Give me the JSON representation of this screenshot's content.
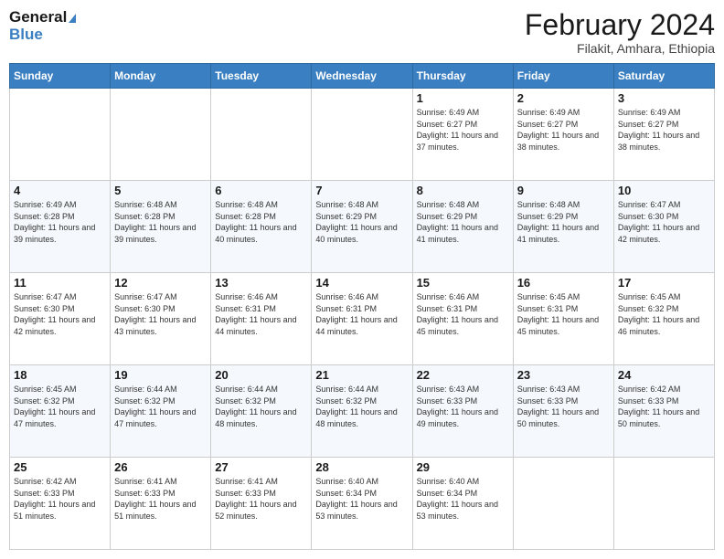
{
  "header": {
    "logo_general": "General",
    "logo_blue": "Blue",
    "title": "February 2024",
    "subtitle": "Filakit, Amhara, Ethiopia"
  },
  "days_of_week": [
    "Sunday",
    "Monday",
    "Tuesday",
    "Wednesday",
    "Thursday",
    "Friday",
    "Saturday"
  ],
  "weeks": [
    [
      {
        "num": "",
        "info": ""
      },
      {
        "num": "",
        "info": ""
      },
      {
        "num": "",
        "info": ""
      },
      {
        "num": "",
        "info": ""
      },
      {
        "num": "1",
        "info": "Sunrise: 6:49 AM\nSunset: 6:27 PM\nDaylight: 11 hours and 37 minutes."
      },
      {
        "num": "2",
        "info": "Sunrise: 6:49 AM\nSunset: 6:27 PM\nDaylight: 11 hours and 38 minutes."
      },
      {
        "num": "3",
        "info": "Sunrise: 6:49 AM\nSunset: 6:27 PM\nDaylight: 11 hours and 38 minutes."
      }
    ],
    [
      {
        "num": "4",
        "info": "Sunrise: 6:49 AM\nSunset: 6:28 PM\nDaylight: 11 hours and 39 minutes."
      },
      {
        "num": "5",
        "info": "Sunrise: 6:48 AM\nSunset: 6:28 PM\nDaylight: 11 hours and 39 minutes."
      },
      {
        "num": "6",
        "info": "Sunrise: 6:48 AM\nSunset: 6:28 PM\nDaylight: 11 hours and 40 minutes."
      },
      {
        "num": "7",
        "info": "Sunrise: 6:48 AM\nSunset: 6:29 PM\nDaylight: 11 hours and 40 minutes."
      },
      {
        "num": "8",
        "info": "Sunrise: 6:48 AM\nSunset: 6:29 PM\nDaylight: 11 hours and 41 minutes."
      },
      {
        "num": "9",
        "info": "Sunrise: 6:48 AM\nSunset: 6:29 PM\nDaylight: 11 hours and 41 minutes."
      },
      {
        "num": "10",
        "info": "Sunrise: 6:47 AM\nSunset: 6:30 PM\nDaylight: 11 hours and 42 minutes."
      }
    ],
    [
      {
        "num": "11",
        "info": "Sunrise: 6:47 AM\nSunset: 6:30 PM\nDaylight: 11 hours and 42 minutes."
      },
      {
        "num": "12",
        "info": "Sunrise: 6:47 AM\nSunset: 6:30 PM\nDaylight: 11 hours and 43 minutes."
      },
      {
        "num": "13",
        "info": "Sunrise: 6:46 AM\nSunset: 6:31 PM\nDaylight: 11 hours and 44 minutes."
      },
      {
        "num": "14",
        "info": "Sunrise: 6:46 AM\nSunset: 6:31 PM\nDaylight: 11 hours and 44 minutes."
      },
      {
        "num": "15",
        "info": "Sunrise: 6:46 AM\nSunset: 6:31 PM\nDaylight: 11 hours and 45 minutes."
      },
      {
        "num": "16",
        "info": "Sunrise: 6:45 AM\nSunset: 6:31 PM\nDaylight: 11 hours and 45 minutes."
      },
      {
        "num": "17",
        "info": "Sunrise: 6:45 AM\nSunset: 6:32 PM\nDaylight: 11 hours and 46 minutes."
      }
    ],
    [
      {
        "num": "18",
        "info": "Sunrise: 6:45 AM\nSunset: 6:32 PM\nDaylight: 11 hours and 47 minutes."
      },
      {
        "num": "19",
        "info": "Sunrise: 6:44 AM\nSunset: 6:32 PM\nDaylight: 11 hours and 47 minutes."
      },
      {
        "num": "20",
        "info": "Sunrise: 6:44 AM\nSunset: 6:32 PM\nDaylight: 11 hours and 48 minutes."
      },
      {
        "num": "21",
        "info": "Sunrise: 6:44 AM\nSunset: 6:32 PM\nDaylight: 11 hours and 48 minutes."
      },
      {
        "num": "22",
        "info": "Sunrise: 6:43 AM\nSunset: 6:33 PM\nDaylight: 11 hours and 49 minutes."
      },
      {
        "num": "23",
        "info": "Sunrise: 6:43 AM\nSunset: 6:33 PM\nDaylight: 11 hours and 50 minutes."
      },
      {
        "num": "24",
        "info": "Sunrise: 6:42 AM\nSunset: 6:33 PM\nDaylight: 11 hours and 50 minutes."
      }
    ],
    [
      {
        "num": "25",
        "info": "Sunrise: 6:42 AM\nSunset: 6:33 PM\nDaylight: 11 hours and 51 minutes."
      },
      {
        "num": "26",
        "info": "Sunrise: 6:41 AM\nSunset: 6:33 PM\nDaylight: 11 hours and 51 minutes."
      },
      {
        "num": "27",
        "info": "Sunrise: 6:41 AM\nSunset: 6:33 PM\nDaylight: 11 hours and 52 minutes."
      },
      {
        "num": "28",
        "info": "Sunrise: 6:40 AM\nSunset: 6:34 PM\nDaylight: 11 hours and 53 minutes."
      },
      {
        "num": "29",
        "info": "Sunrise: 6:40 AM\nSunset: 6:34 PM\nDaylight: 11 hours and 53 minutes."
      },
      {
        "num": "",
        "info": ""
      },
      {
        "num": "",
        "info": ""
      }
    ]
  ],
  "colors": {
    "header_bg": "#3a7fc1",
    "header_text": "#ffffff",
    "border": "#cccccc"
  }
}
